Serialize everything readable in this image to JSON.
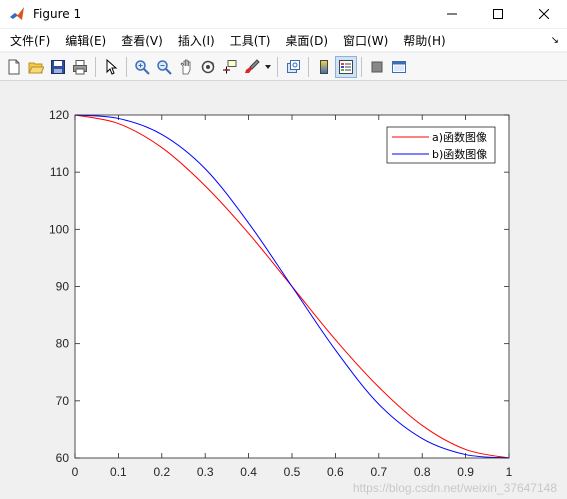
{
  "window": {
    "title": "Figure 1"
  },
  "menu": {
    "items": [
      "文件(F)",
      "编辑(E)",
      "查看(V)",
      "插入(I)",
      "工具(T)",
      "桌面(D)",
      "窗口(W)",
      "帮助(H)"
    ],
    "overflow": "↘"
  },
  "toolbar": {
    "icons": [
      "new-figure-icon",
      "open-file-icon",
      "save-icon",
      "print-icon",
      "pointer-icon",
      "zoom-in-icon",
      "zoom-out-icon",
      "pan-icon",
      "rotate-3d-icon",
      "data-cursor-icon",
      "brush-icon",
      "link-plot-icon",
      "colorbar-icon",
      "legend-icon",
      "hide-plot-tools-icon",
      "show-plot-tools-icon"
    ]
  },
  "watermark": "https://blog.csdn.net/weixin_37647148",
  "chart_data": {
    "type": "line",
    "xlim": [
      0,
      1
    ],
    "ylim": [
      60,
      120
    ],
    "xticks": [
      "0",
      "0.1",
      "0.2",
      "0.3",
      "0.4",
      "0.5",
      "0.6",
      "0.7",
      "0.8",
      "0.9",
      "1"
    ],
    "yticks": [
      "60",
      "70",
      "80",
      "90",
      "100",
      "110",
      "120"
    ],
    "grid": false,
    "legend": "top-right",
    "series": [
      {
        "name": "a)函数图像",
        "color": "#ff0000",
        "x": [
          0,
          0.1,
          0.2,
          0.3,
          0.4,
          0.5,
          0.6,
          0.7,
          0.8,
          0.9,
          1
        ],
        "y": [
          120,
          118.5,
          114.3,
          107.6,
          99.3,
          90,
          80.7,
          72.4,
          65.7,
          61.5,
          60
        ]
      },
      {
        "name": "b)函数图像",
        "color": "#0000ff",
        "x": [
          0,
          0.1,
          0.2,
          0.3,
          0.4,
          0.5,
          0.6,
          0.7,
          0.8,
          0.9,
          1
        ],
        "y": [
          120,
          119.4,
          116.6,
          110.6,
          101.1,
          90,
          78.9,
          69.4,
          63.4,
          60.6,
          60
        ]
      }
    ]
  }
}
